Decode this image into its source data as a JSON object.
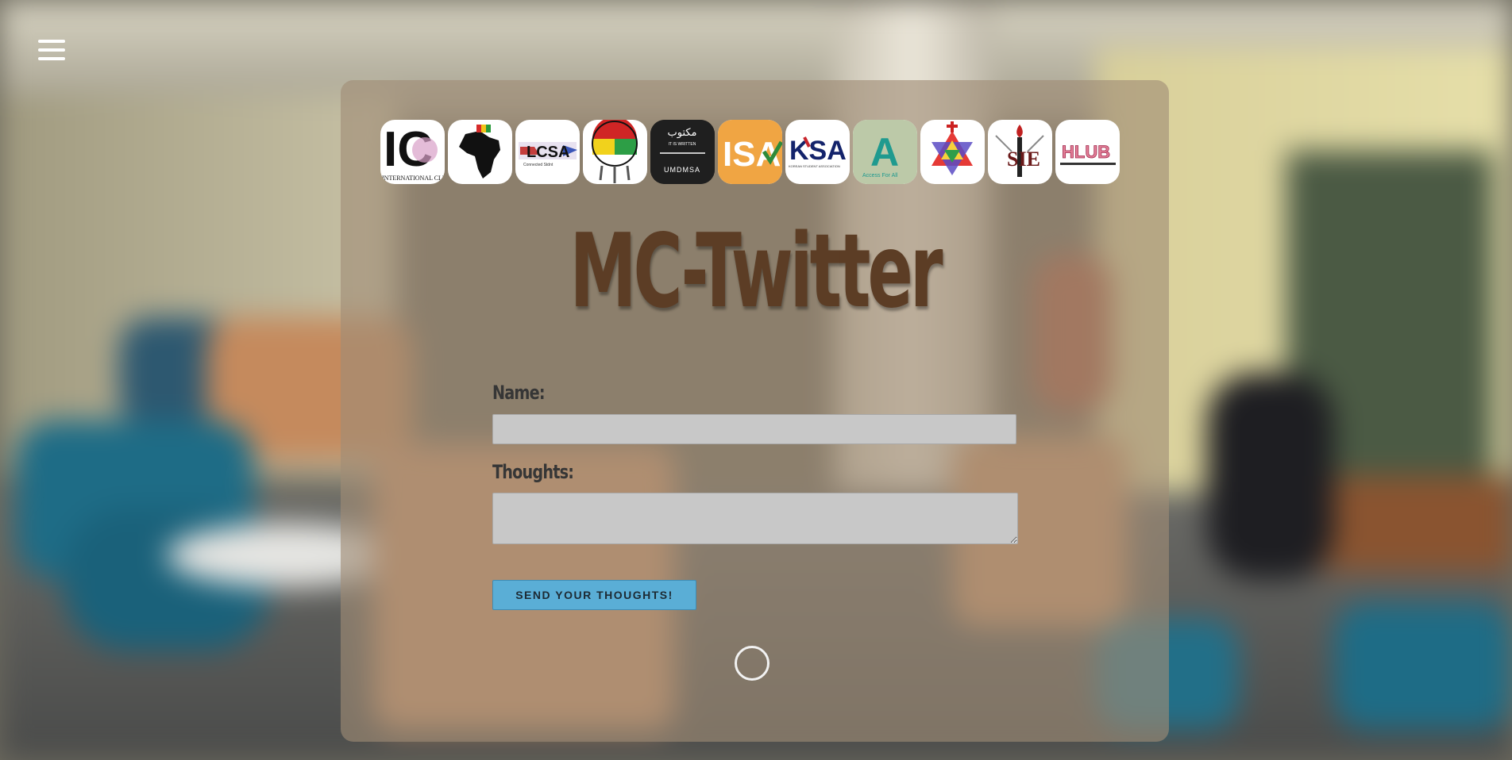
{
  "menu": {
    "icon": "hamburger-menu-icon"
  },
  "logos": [
    {
      "name": "international-club-logo",
      "text": "IC",
      "subtext": "INTERNATIONAL CLUB"
    },
    {
      "name": "african-student-logo",
      "text": ""
    },
    {
      "name": "lcsa-logo",
      "text": "LCSA",
      "subtext": "Connected Stdnt"
    },
    {
      "name": "anishinaabe-student-logo",
      "text": ""
    },
    {
      "name": "umd-msa-logo",
      "text": "UMDMSA",
      "subtext": "مكتوب",
      "tagline": "IT IS WRITTEN"
    },
    {
      "name": "isa-logo",
      "text": "ISA"
    },
    {
      "name": "ksa-logo",
      "text": "KSA",
      "subtext": "KOREAN STUDENT ASSOCIATION"
    },
    {
      "name": "access-for-all-logo",
      "text": "A",
      "subtext": "Access For All"
    },
    {
      "name": "star-of-david-logo",
      "text": ""
    },
    {
      "name": "sie-logo",
      "text": "SIE"
    },
    {
      "name": "hlub-logo",
      "text": "HLUB"
    }
  ],
  "title": "MC-Twitter",
  "form": {
    "name_label": "Name:",
    "name_value": "",
    "thoughts_label": "Thoughts:",
    "thoughts_value": "",
    "send_label": "SEND YOUR THOUGHTS!"
  },
  "colors": {
    "panel": "#a08c76",
    "title": "#5c3d25",
    "button": "#5aaed6"
  }
}
